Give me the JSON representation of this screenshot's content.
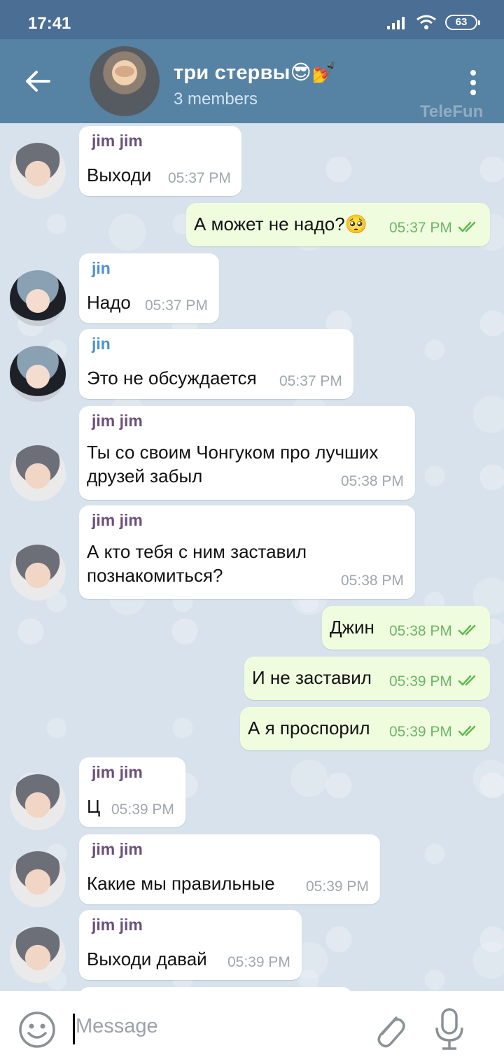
{
  "status_bar": {
    "time": "17:41",
    "battery": "63"
  },
  "header": {
    "title": "три стервы😎💅",
    "subtitle": "3 members",
    "watermark": "TeleFun"
  },
  "messages": [
    {
      "side": "in",
      "sender": "jim jim",
      "text": "Выходи",
      "time": "05:37 PM"
    },
    {
      "side": "out",
      "text": "А может не надо?🥺",
      "time": "05:37 PM"
    },
    {
      "side": "in",
      "sender": "jin",
      "text": "Надо",
      "time": "05:37 PM"
    },
    {
      "side": "in",
      "sender": "jin",
      "text": "Это не обсуждается",
      "time": "05:37 PM"
    },
    {
      "side": "in",
      "sender": "jim jim",
      "text_line1": "Ты со своим Чонгуком про лучших",
      "text_line2": "друзей забыл",
      "time": "05:38 PM"
    },
    {
      "side": "in",
      "sender": "jim jim",
      "text_line1": "А кто тебя с ним заставил",
      "text_line2": "познакомиться?",
      "time": "05:38 PM"
    },
    {
      "side": "out",
      "text": "Джин",
      "time": "05:38 PM"
    },
    {
      "side": "out",
      "text": "И не заставил",
      "time": "05:39 PM"
    },
    {
      "side": "out",
      "text": "А я проспорил",
      "time": "05:39 PM"
    },
    {
      "side": "in",
      "sender": "jim jim",
      "text": "Ц",
      "time": "05:39 PM"
    },
    {
      "side": "in",
      "sender": "jim jim",
      "text": "Какие мы правильные",
      "time": "05:39 PM"
    },
    {
      "side": "in",
      "sender": "jim jim",
      "text": "Выходи давай",
      "time": "05:39 PM"
    }
  ],
  "colors": {
    "jimjim": "#6b4f7a",
    "jin": "#4d91d1",
    "check": "#5fb84f"
  },
  "input": {
    "placeholder": "Message"
  },
  "icons": [
    "back-arrow-icon",
    "more-vert-icon",
    "smile-icon",
    "paperclip-icon",
    "microphone-icon",
    "double-check-icon",
    "signal-icon",
    "wifi-icon"
  ]
}
